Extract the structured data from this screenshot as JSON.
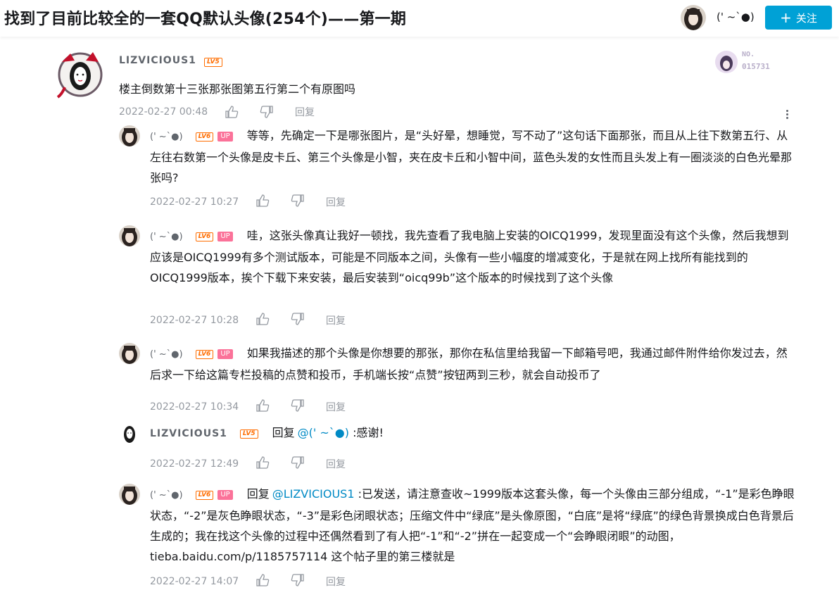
{
  "header": {
    "title": "找到了目前比较全的一套QQ默认头像(254个)——第一期",
    "author_name": "(' ~`●)",
    "follow_label": "关注",
    "follow_icon": "plus-icon"
  },
  "main_comment": {
    "user": "LIZVICIOUS1",
    "level": "LV5",
    "badge_text": "NO.",
    "badge_number": "015731",
    "text": "楼主倒数第十三张那张图第五行第二个有原图吗",
    "time": "2022-02-27 00:48",
    "reply_label": "回复"
  },
  "replies": [
    {
      "user": "(' ~`●)",
      "level": "LV6",
      "up": "UP",
      "reply_prefix": "",
      "reply_to": "",
      "text": "等等，先确定一下是哪张图片，是“头好晕，想睡觉，写不动了”这句话下面那张，而且从上往下数第五行、从左往右数第一个头像是皮卡丘、第三个头像是小智，夹在皮卡丘和小智中间，蓝色头发的女性而且头发上有一圈淡淡的白色光晕那张吗?",
      "time": "2022-02-27 10:27",
      "reply_label": "回复"
    },
    {
      "user": "(' ~`●)",
      "level": "LV6",
      "up": "UP",
      "reply_prefix": "",
      "reply_to": "",
      "text": "哇，这张头像真让我好一顿找，我先查看了我电脑上安装的OICQ1999，发现里面没有这个头像，然后我想到应该是OICQ1999有多个测试版本，可能是不同版本之间，头像有一些小幅度的增减变化，于是就在网上找所有能找到的OICQ1999版本，挨个下载下来安装，最后安装到“oicq99b”这个版本的时候找到了这个头像",
      "time": "2022-02-27 10:28",
      "reply_label": "回复"
    },
    {
      "user": "(' ~`●)",
      "level": "LV6",
      "up": "UP",
      "reply_prefix": "",
      "reply_to": "",
      "text": "如果我描述的那个头像是你想要的那张，那你在私信里给我留一下邮箱号吧，我通过邮件附件给你发过去，然后求一下给这篇专栏投稿的点赞和投币，手机端长按“点赞”按钮两到三秒，就会自动投币了",
      "time": "2022-02-27 10:34",
      "reply_label": "回复"
    },
    {
      "user": "LIZVICIOUS1",
      "level": "LV5",
      "up": "",
      "reply_prefix": "回复",
      "reply_to": "@(' ~`●)",
      "text": ":感谢!",
      "time": "2022-02-27 12:49",
      "reply_label": "回复"
    },
    {
      "user": "(' ~`●)",
      "level": "LV6",
      "up": "UP",
      "reply_prefix": "回复",
      "reply_to": "@LIZVICIOUS1",
      "text": ":已发送，请注意查收~1999版本这套头像，每一个头像由三部分组成，“-1”是彩色睁眼状态，“-2”是灰色睁眼状态，“-3”是彩色闭眼状态；压缩文件中“绿底”是头像原图，“白底”是将“绿底”的绿色背景换成白色背景后生成的；我在找这个头像的过程中还偶然看到了有人把“-1”和“-2”拼在一起变成一个“会睁眼闭眼”的动图，tieba.baidu.com/p/1185757114 这个帖子里的第三楼就是",
      "time": "2022-02-27 14:07",
      "reply_label": "回复"
    }
  ],
  "colors": {
    "accent": "#00a1d6",
    "level_orange": "#ff6d00",
    "up_pink": "#fb7299",
    "link_blue": "#008ac5",
    "muted": "#9499a0"
  }
}
